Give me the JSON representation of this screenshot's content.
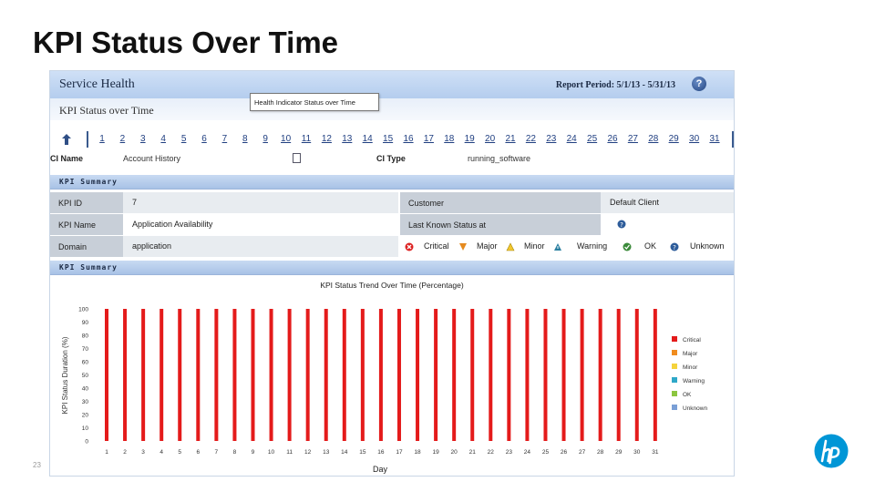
{
  "slide": {
    "title": "KPI Status Over Time",
    "page_number": "23"
  },
  "app": {
    "title": "Service Health",
    "report_period": "Report Period: 5/1/13 - 5/31/13",
    "help_icon": "?",
    "subtitle": "KPI Status over Time"
  },
  "day_nav": [
    "1",
    "2",
    "3",
    "4",
    "5",
    "6",
    "7",
    "8",
    "9",
    "10",
    "11",
    "12",
    "13",
    "14",
    "15",
    "16",
    "17",
    "18",
    "19",
    "20",
    "21",
    "22",
    "23",
    "24",
    "25",
    "26",
    "27",
    "28",
    "29",
    "30",
    "31"
  ],
  "ci": {
    "name_label": "CI Name",
    "name_value": "Account History",
    "type_label": "CI Type",
    "type_value": "running_software"
  },
  "tooltip": "Health Indicator Status over Time",
  "kpi_summary": {
    "title": "KPI Summary",
    "kpi_id_label": "KPI ID",
    "kpi_id": "7",
    "kpi_name_label": "KPI Name",
    "kpi_name": "Application Availability",
    "domain_label": "Domain",
    "domain": "application",
    "customer_label": "Customer",
    "customer": "Default Client",
    "last_status_label": "Last Known Status at"
  },
  "status_legend": [
    "Critical",
    "Major",
    "Minor",
    "Warning",
    "OK",
    "Unknown"
  ],
  "chart_panel": {
    "title": "KPI Summary"
  },
  "colors": {
    "critical": "#e41b1b",
    "major": "#f08c1e",
    "minor": "#f5d33c",
    "warning": "#2ea8c8",
    "ok": "#8cc63f",
    "unknown": "#7a9fd6"
  },
  "chart_data": {
    "type": "bar",
    "title": "KPI Status Trend Over Time (Percentage)",
    "xlabel": "Day",
    "ylabel": "KPI Status Duration (%)",
    "ylim": [
      0,
      100
    ],
    "yticks": [
      0,
      10,
      20,
      30,
      40,
      50,
      60,
      70,
      80,
      90,
      100
    ],
    "categories": [
      "1",
      "2",
      "3",
      "4",
      "5",
      "6",
      "7",
      "8",
      "9",
      "10",
      "11",
      "12",
      "13",
      "14",
      "15",
      "16",
      "17",
      "18",
      "19",
      "20",
      "21",
      "22",
      "23",
      "24",
      "25",
      "26",
      "27",
      "28",
      "29",
      "30",
      "31"
    ],
    "series": [
      {
        "name": "Critical",
        "values": [
          100,
          100,
          100,
          100,
          100,
          100,
          100,
          100,
          100,
          100,
          100,
          100,
          100,
          100,
          100,
          100,
          100,
          100,
          100,
          100,
          100,
          100,
          100,
          100,
          100,
          100,
          100,
          100,
          100,
          100,
          100
        ]
      },
      {
        "name": "Major",
        "values": [
          0,
          0,
          0,
          0,
          0,
          0,
          0,
          0,
          0,
          0,
          0,
          0,
          0,
          0,
          0,
          0,
          0,
          0,
          0,
          0,
          0,
          0,
          0,
          0,
          0,
          0,
          0,
          0,
          0,
          0,
          0
        ]
      },
      {
        "name": "Minor",
        "values": [
          0,
          0,
          0,
          0,
          0,
          0,
          0,
          0,
          0,
          0,
          0,
          0,
          0,
          0,
          0,
          0,
          0,
          0,
          0,
          0,
          0,
          0,
          0,
          0,
          0,
          0,
          0,
          0,
          0,
          0,
          0
        ]
      },
      {
        "name": "Warning",
        "values": [
          0,
          0,
          0,
          0,
          0,
          0,
          0,
          0,
          0,
          0,
          0,
          0,
          0,
          0,
          0,
          0,
          0,
          0,
          0,
          0,
          0,
          0,
          0,
          0,
          0,
          0,
          0,
          0,
          0,
          0,
          0
        ]
      },
      {
        "name": "OK",
        "values": [
          0,
          0,
          0,
          0,
          0,
          0,
          0,
          0,
          0,
          0,
          0,
          0,
          0,
          0,
          0,
          0,
          0,
          0,
          0,
          0,
          0,
          0,
          0,
          0,
          0,
          0,
          0,
          0,
          0,
          0,
          0
        ]
      },
      {
        "name": "Unknown",
        "values": [
          0,
          0,
          0,
          0,
          0,
          0,
          0,
          0,
          0,
          0,
          0,
          0,
          0,
          0,
          0,
          0,
          0,
          0,
          0,
          0,
          0,
          0,
          0,
          0,
          0,
          0,
          0,
          0,
          0,
          0,
          0
        ]
      }
    ],
    "grid": false,
    "legend": "right"
  }
}
